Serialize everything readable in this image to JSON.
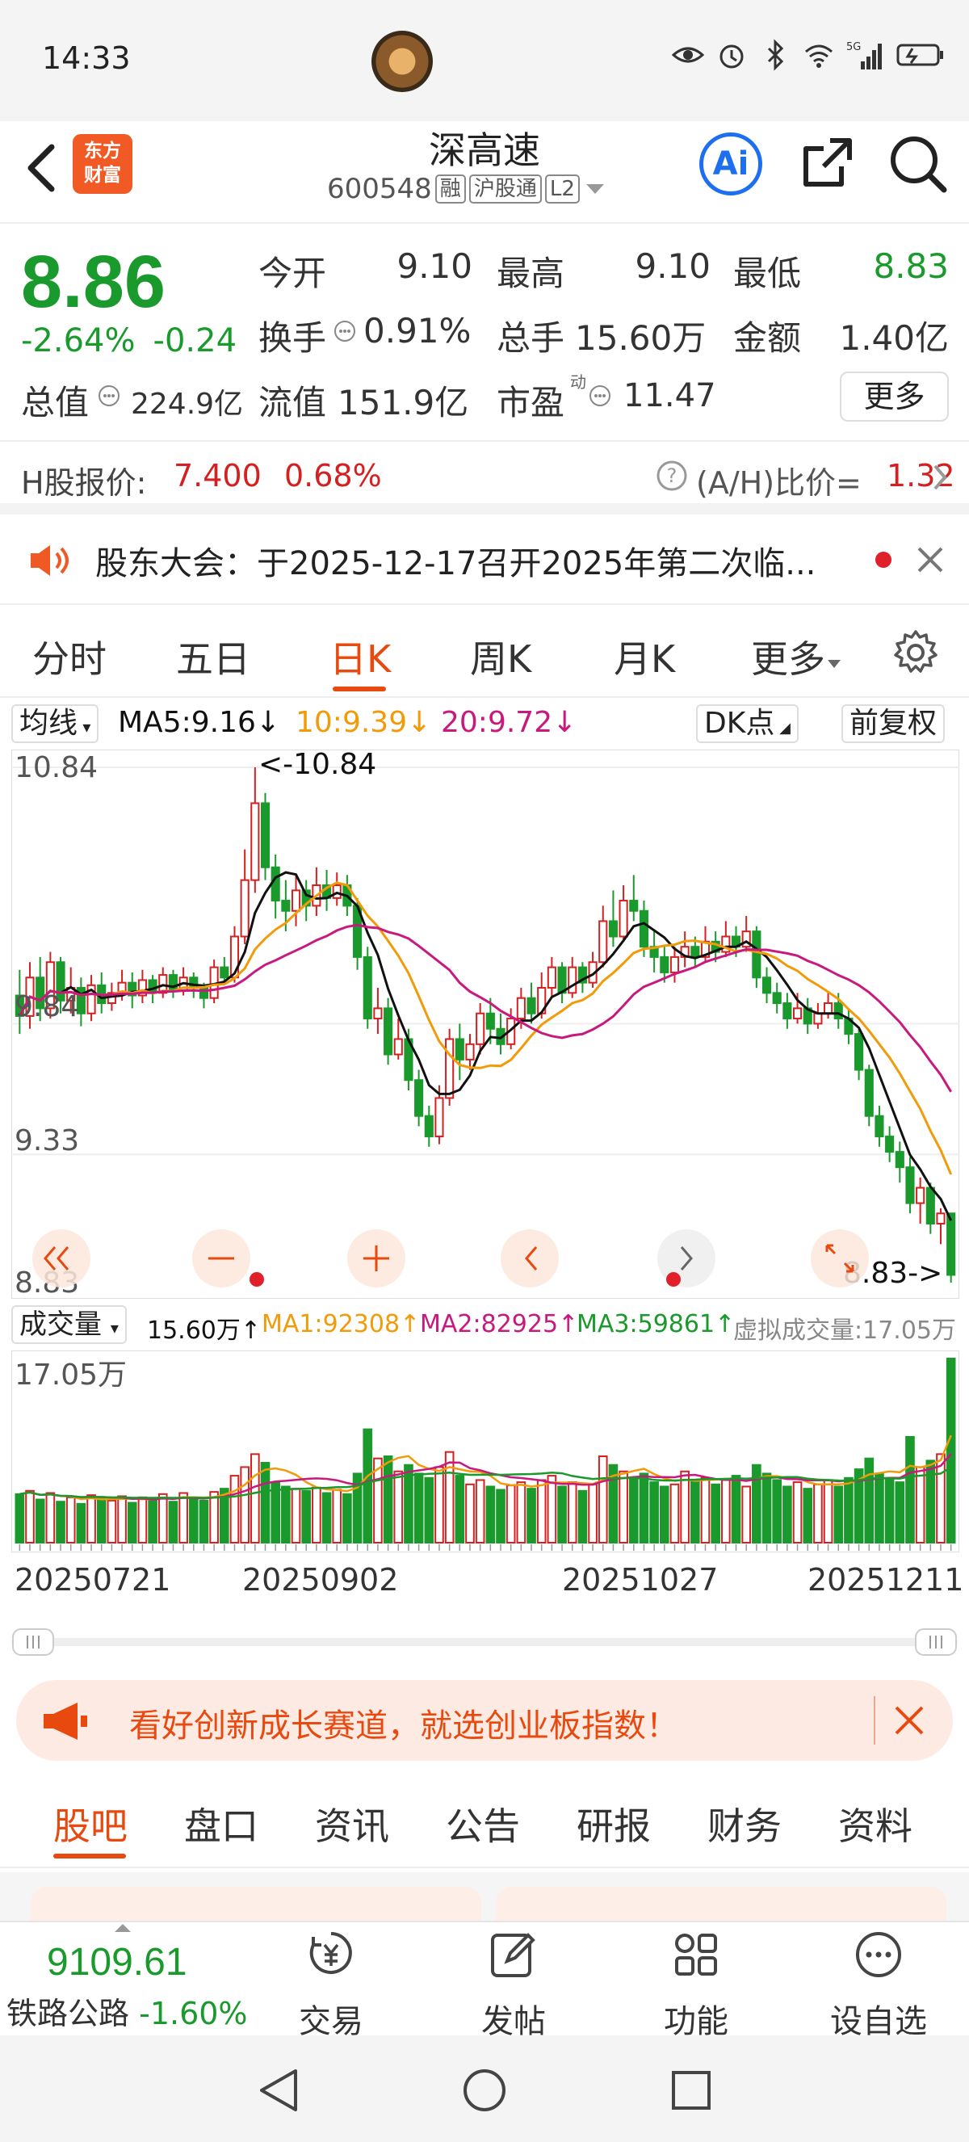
{
  "status_bar": {
    "time": "14:33",
    "network": "5G"
  },
  "header": {
    "logo_line1": "东方",
    "logo_line2": "财富",
    "stock_name": "深高速",
    "stock_code": "600548",
    "tags": [
      "融",
      "沪股通",
      "L2"
    ],
    "ai_label": "Ai"
  },
  "quote": {
    "price": "8.86",
    "change_pct": "-2.64%",
    "change_amt": "-0.24",
    "open_label": "今开",
    "open": "9.10",
    "high_label": "最高",
    "high": "9.10",
    "low_label": "最低",
    "low": "8.83",
    "turnover_label": "换手",
    "turnover": "0.91%",
    "volume_label": "总手",
    "volume": "15.60万",
    "amount_label": "金额",
    "amount": "1.40亿",
    "mktcap_label": "总值",
    "mktcap": "224.9亿",
    "float_label": "流值",
    "float": "151.9亿",
    "pe_label": "市盈",
    "pe_sup": "动",
    "pe": "11.47",
    "more": "更多"
  },
  "hshare": {
    "label": "H股报价:",
    "price": "7.400",
    "pct": "0.68%",
    "ah_label": "(A/H)比价=",
    "ah_value": "1.32"
  },
  "notice": {
    "text": "股东大会：于2025-12-17召开2025年第二次临..."
  },
  "kline_tabs": [
    {
      "label": "分时"
    },
    {
      "label": "五日"
    },
    {
      "label": "日K"
    },
    {
      "label": "周K"
    },
    {
      "label": "月K"
    },
    {
      "label": "更多"
    }
  ],
  "ma_row": {
    "selector": "均线",
    "ma5": "MA5:9.16↓",
    "ma10": "10:9.39↓",
    "ma20": "20:9.72↓",
    "dk": "DK点",
    "adjust": "前复权"
  },
  "colors": {
    "up": "#d42020",
    "down": "#1a9a2c",
    "ma5": "#111111",
    "ma10": "#f29b0a",
    "ma20": "#c8197e",
    "accent": "#e8490f"
  },
  "chart_data": {
    "type": "candlestick",
    "price_axis_labels": [
      "10.84",
      "9.84",
      "9.33",
      "8.83"
    ],
    "ylim": [
      8.83,
      10.84
    ],
    "max_marker": "<-10.84",
    "min_marker": "8.83->",
    "candles": [
      [
        9.95,
        9.87,
        10.05,
        9.8
      ],
      [
        9.87,
        10.02,
        10.08,
        9.82
      ],
      [
        10.02,
        9.9,
        10.1,
        9.85
      ],
      [
        9.9,
        10.08,
        10.12,
        9.86
      ],
      [
        10.08,
        9.93,
        10.1,
        9.88
      ],
      [
        9.93,
        9.98,
        10.06,
        9.88
      ],
      [
        9.98,
        9.88,
        10.02,
        9.83
      ],
      [
        9.88,
        9.99,
        10.03,
        9.85
      ],
      [
        9.99,
        9.92,
        10.04,
        9.88
      ],
      [
        9.92,
        9.96,
        10.0,
        9.89
      ],
      [
        9.96,
        10.0,
        10.05,
        9.93
      ],
      [
        10.0,
        9.95,
        10.04,
        9.9
      ],
      [
        9.95,
        10.01,
        10.05,
        9.92
      ],
      [
        10.01,
        9.96,
        10.03,
        9.92
      ],
      [
        9.96,
        10.03,
        10.06,
        9.94
      ],
      [
        10.03,
        9.97,
        10.05,
        9.94
      ],
      [
        9.97,
        10.02,
        10.06,
        9.95
      ],
      [
        10.02,
        9.98,
        10.04,
        9.94
      ],
      [
        9.98,
        9.94,
        10.0,
        9.9
      ],
      [
        9.94,
        10.06,
        10.09,
        9.92
      ],
      [
        10.06,
        10.02,
        10.1,
        10.0
      ],
      [
        10.02,
        10.18,
        10.22,
        10.0
      ],
      [
        10.18,
        10.4,
        10.52,
        10.15
      ],
      [
        10.4,
        10.7,
        10.84,
        10.35
      ],
      [
        10.7,
        10.45,
        10.74,
        10.4
      ],
      [
        10.45,
        10.32,
        10.5,
        10.25
      ],
      [
        10.32,
        10.28,
        10.4,
        10.2
      ],
      [
        10.28,
        10.36,
        10.42,
        10.22
      ],
      [
        10.36,
        10.3,
        10.4,
        10.24
      ],
      [
        10.3,
        10.38,
        10.45,
        10.26
      ],
      [
        10.38,
        10.33,
        10.44,
        10.28
      ],
      [
        10.33,
        10.38,
        10.43,
        10.3
      ],
      [
        10.38,
        10.3,
        10.42,
        10.26
      ],
      [
        10.3,
        10.1,
        10.33,
        10.05
      ],
      [
        10.1,
        9.86,
        10.14,
        9.82
      ],
      [
        9.86,
        9.9,
        9.98,
        9.8
      ],
      [
        9.9,
        9.72,
        9.94,
        9.68
      ],
      [
        9.72,
        9.78,
        9.86,
        9.7
      ],
      [
        9.78,
        9.62,
        9.82,
        9.58
      ],
      [
        9.62,
        9.48,
        9.66,
        9.44
      ],
      [
        9.48,
        9.4,
        9.52,
        9.36
      ],
      [
        9.4,
        9.55,
        9.6,
        9.37
      ],
      [
        9.55,
        9.78,
        9.82,
        9.52
      ],
      [
        9.78,
        9.7,
        9.84,
        9.62
      ],
      [
        9.7,
        9.76,
        9.8,
        9.66
      ],
      [
        9.76,
        9.88,
        9.92,
        9.72
      ],
      [
        9.88,
        9.82,
        9.94,
        9.76
      ],
      [
        9.82,
        9.76,
        9.88,
        9.72
      ],
      [
        9.76,
        9.86,
        9.9,
        9.74
      ],
      [
        9.86,
        9.94,
        9.98,
        9.82
      ],
      [
        9.94,
        9.88,
        10.0,
        9.84
      ],
      [
        9.88,
        9.98,
        10.04,
        9.86
      ],
      [
        9.98,
        10.06,
        10.1,
        9.94
      ],
      [
        10.06,
        9.96,
        10.08,
        9.92
      ],
      [
        9.96,
        10.06,
        10.1,
        9.94
      ],
      [
        10.06,
        10.0,
        10.08,
        9.96
      ],
      [
        10.0,
        10.08,
        10.12,
        9.98
      ],
      [
        10.08,
        10.24,
        10.3,
        10.06
      ],
      [
        10.24,
        10.18,
        10.36,
        10.14
      ],
      [
        10.18,
        10.32,
        10.38,
        10.16
      ],
      [
        10.32,
        10.28,
        10.42,
        10.24
      ],
      [
        10.28,
        10.14,
        10.32,
        10.1
      ],
      [
        10.14,
        10.1,
        10.2,
        10.04
      ],
      [
        10.1,
        10.04,
        10.14,
        10.0
      ],
      [
        10.04,
        10.1,
        10.14,
        10.0
      ],
      [
        10.1,
        10.14,
        10.2,
        10.06
      ],
      [
        10.14,
        10.1,
        10.18,
        10.06
      ],
      [
        10.1,
        10.16,
        10.22,
        10.08
      ],
      [
        10.16,
        10.12,
        10.2,
        10.08
      ],
      [
        10.12,
        10.18,
        10.24,
        10.1
      ],
      [
        10.18,
        10.14,
        10.22,
        10.1
      ],
      [
        10.14,
        10.2,
        10.26,
        10.12
      ],
      [
        10.2,
        10.02,
        10.22,
        9.98
      ],
      [
        10.02,
        9.96,
        10.06,
        9.92
      ],
      [
        9.96,
        9.92,
        10.0,
        9.88
      ],
      [
        9.92,
        9.86,
        9.96,
        9.82
      ],
      [
        9.86,
        9.9,
        9.96,
        9.84
      ],
      [
        9.9,
        9.84,
        9.94,
        9.8
      ],
      [
        9.84,
        9.88,
        9.92,
        9.82
      ],
      [
        9.88,
        9.92,
        9.96,
        9.86
      ],
      [
        9.92,
        9.86,
        9.96,
        9.82
      ],
      [
        9.86,
        9.8,
        9.9,
        9.76
      ],
      [
        9.8,
        9.66,
        9.82,
        9.62
      ],
      [
        9.66,
        9.48,
        9.68,
        9.44
      ],
      [
        9.48,
        9.4,
        9.52,
        9.36
      ],
      [
        9.4,
        9.34,
        9.44,
        9.3
      ],
      [
        9.34,
        9.28,
        9.38,
        9.22
      ],
      [
        9.28,
        9.14,
        9.32,
        9.1
      ],
      [
        9.14,
        9.2,
        9.24,
        9.06
      ],
      [
        9.2,
        9.06,
        9.22,
        9.02
      ],
      [
        9.06,
        9.1,
        9.12,
        8.98
      ],
      [
        9.1,
        8.86,
        9.1,
        8.83
      ]
    ],
    "volume": {
      "current": "15.60万↑",
      "ma1": "MA1:92308↑",
      "ma2": "MA2:82925↑",
      "ma3": "MA3:59861↑",
      "virtual": "虚拟成交量:17.05万",
      "axis_max": "17.05万",
      "values": [
        4.5,
        4.8,
        4.0,
        4.6,
        3.8,
        4.2,
        3.6,
        4.4,
        4.1,
        3.9,
        4.3,
        3.7,
        4.2,
        4.0,
        4.5,
        3.8,
        4.6,
        4.1,
        3.9,
        4.7,
        5.0,
        6.2,
        7.0,
        8.2,
        7.4,
        5.6,
        5.2,
        5.0,
        4.8,
        5.1,
        4.6,
        4.9,
        4.5,
        6.4,
        10.5,
        7.8,
        8.0,
        6.6,
        7.2,
        6.4,
        6.0,
        7.0,
        8.4,
        6.2,
        5.4,
        5.8,
        5.2,
        4.9,
        5.3,
        5.6,
        5.0,
        5.8,
        6.2,
        5.2,
        5.6,
        4.8,
        5.4,
        8.0,
        7.2,
        6.6,
        6.0,
        6.4,
        5.6,
        5.2,
        5.4,
        6.6,
        5.8,
        6.0,
        5.4,
        5.8,
        6.2,
        5.2,
        7.2,
        6.4,
        5.8,
        5.2,
        5.6,
        5.0,
        5.4,
        5.8,
        5.2,
        6.0,
        6.8,
        7.8,
        6.4,
        6.0,
        5.6,
        9.8,
        7.0,
        7.6,
        8.2,
        17.05
      ]
    },
    "dates": [
      "20250721",
      "20250902",
      "20251027",
      "20251211"
    ]
  },
  "banner": {
    "text": "看好创新成长赛道，就选创业板指数！"
  },
  "bottom_tabs": [
    {
      "label": "股吧"
    },
    {
      "label": "盘口"
    },
    {
      "label": "资讯"
    },
    {
      "label": "公告"
    },
    {
      "label": "研报"
    },
    {
      "label": "财务"
    },
    {
      "label": "资料"
    }
  ],
  "bottom_nav": {
    "index_value": "9109.61",
    "index_name": "铁路公路",
    "index_pct": "-1.60%",
    "items": [
      {
        "label": "交易"
      },
      {
        "label": "发帖"
      },
      {
        "label": "功能"
      },
      {
        "label": "设自选"
      }
    ]
  }
}
